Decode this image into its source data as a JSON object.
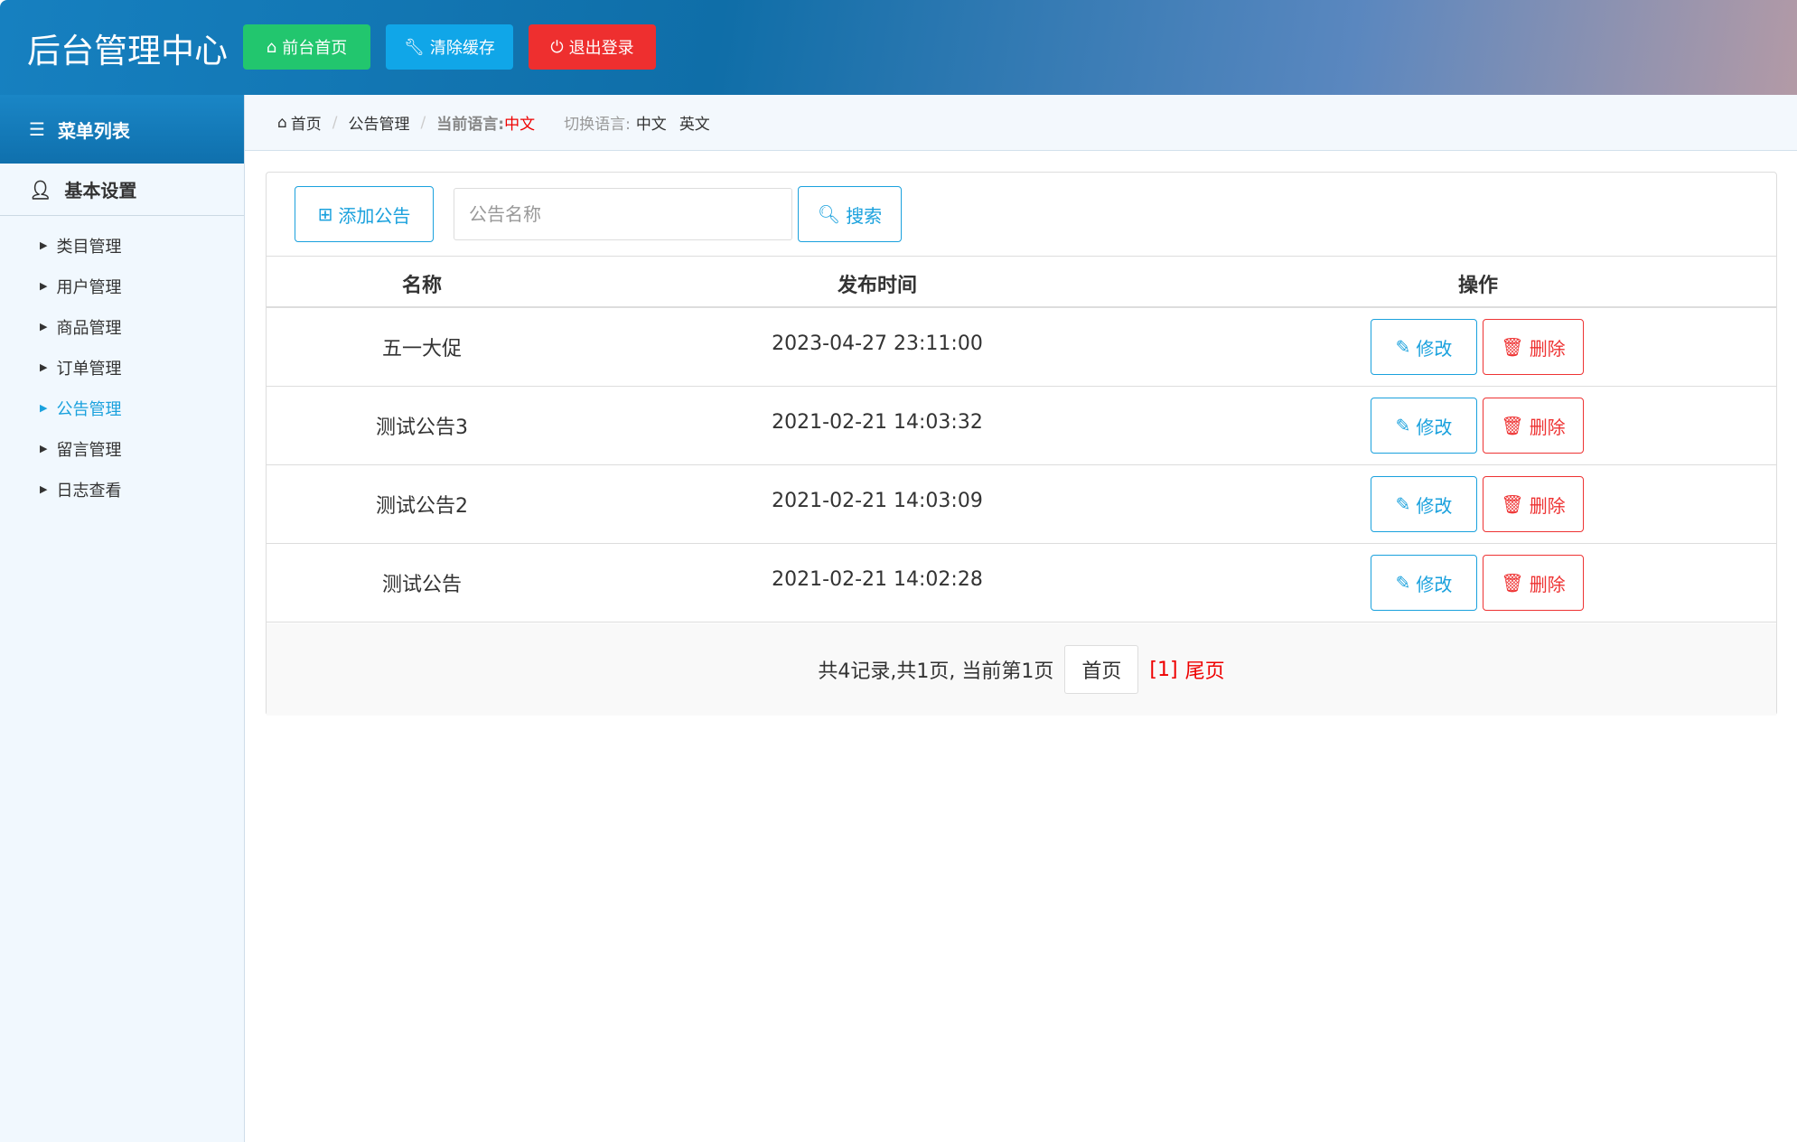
{
  "header": {
    "title": "后台管理中心",
    "buttons": [
      {
        "label": "前台首页",
        "icon": "home-icon",
        "color": "#22c66e"
      },
      {
        "label": "清除缓存",
        "icon": "wrench-icon",
        "color": "#10a6e8"
      },
      {
        "label": "退出登录",
        "icon": "power-icon",
        "color": "#ee2f2f"
      }
    ]
  },
  "sidebar": {
    "heading": "菜单列表",
    "group": "基本设置",
    "items": [
      "类目管理",
      "用户管理",
      "商品管理",
      "订单管理",
      "公告管理",
      "留言管理",
      "日志查看"
    ],
    "active_index": 4
  },
  "breadcrumb": {
    "home": "首页",
    "page": "公告管理",
    "current_lang_label": "当前语言:",
    "current_lang": "中文",
    "switch_label": "切换语言:",
    "lang_options": [
      "中文",
      "英文"
    ]
  },
  "toolbar": {
    "add_label": "添加公告",
    "search_placeholder": "公告名称",
    "search_value": "",
    "search_label": "搜索"
  },
  "table": {
    "headers": [
      "名称",
      "发布时间",
      "操作"
    ],
    "rows": [
      {
        "name": "五一大促",
        "time": "2023-04-27 23:11:00"
      },
      {
        "name": "测试公告3",
        "time": "2021-02-21 14:03:32"
      },
      {
        "name": "测试公告2",
        "time": "2021-02-21 14:03:09"
      },
      {
        "name": "测试公告",
        "time": "2021-02-21 14:02:28"
      }
    ],
    "edit_label": "修改",
    "delete_label": "删除"
  },
  "pagination": {
    "summary": "共4记录,共1页, 当前第1页",
    "first": "首页",
    "current": "[1]",
    "last": "尾页"
  }
}
